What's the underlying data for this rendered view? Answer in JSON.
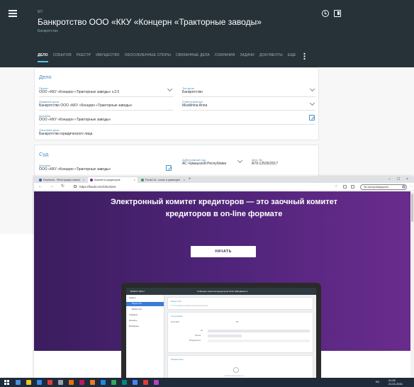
{
  "app": {
    "header": {
      "kicker": "БП",
      "title": "Банкротство ООО «ККУ «Концерн «Тракторные заводы»",
      "subtitle": "Банкротство"
    },
    "tabs": [
      "ДЕЛО",
      "СОБЫТИЯ",
      "РЕЕСТР",
      "ИМУЩЕСТВО",
      "ОБОСОБЛЕННЫЕ СПОРЫ",
      "СВЯЗАННЫЕ ДЕЛА",
      "СОБРАНИЯ",
      "ЗАДАЧИ",
      "ДОКУМЕНТЫ",
      "ЕЩЕ"
    ],
    "case_card": {
      "title": "Дело",
      "project_label": "Проект",
      "project_value": "ООО «ККУ «Концерн «Тракторные заводы» v.2.0",
      "case_type_label": "Тип дела",
      "case_type_value": "Банкротство",
      "case_name_label": "Название дела",
      "case_name_value": "Банкротство ООО «ККУ «Концерн «Тракторные заводы»",
      "responsible_label": "Ответственный",
      "responsible_value": "Musikhina Anna",
      "debtor_label": "Должник",
      "debtor_value": "ООО «ККУ «Концерн «Тракторные заводы»",
      "description_label": "Описание дела",
      "description_value": "Банкротство юридического лица"
    },
    "court_card": {
      "title": "Суд",
      "debtor_label": "Должник",
      "debtor_value": "ООО «ККУ «Концерн «Тракторные заводы»",
      "court_label": "Арбитражный суд",
      "court_value": "АС Чувашской Республики",
      "case_no_label": "Дело №",
      "case_no_value": "А79-12535/2017"
    }
  },
  "browser": {
    "tabs": [
      {
        "label": "Facebook - Регистрация нового",
        "close": "×",
        "favicon_color": "#3b5998",
        "active": false
      },
      {
        "label": "Комитеты кредиторов",
        "close": "×",
        "favicon_color": "#6a2c8e",
        "active": true
      },
      {
        "label": "Portal CA - поиск и размещен",
        "close": "×",
        "favicon_color": "#2e9e57",
        "active": false
      }
    ],
    "new_tab": "+",
    "window_controls": [
      "–",
      "☐",
      "×"
    ],
    "nav": {
      "back": "←",
      "forward": "→",
      "reload": "↻"
    },
    "url": "https://banko.tech/komitet",
    "toolbar_icons": [
      "☆",
      "⋯"
    ],
    "profile_label": "Не синхронизируется",
    "hero": {
      "line1": "Электронный комитет кредиторов — это заочный комитет",
      "line2": "кредиторов в on-line формате",
      "button": "НАЧАТЬ"
    },
    "mockup": {
      "logo": "BANKO.TECH",
      "title": "Собрание комитета кредиторов ООО ЛайтДевелоп",
      "sidebar_items": [
        "Комитет",
        "Вопрос №1",
        "Вопрос №2",
        "Собрания",
        "Контакты",
        "Материалы"
      ],
      "question_title": "Вопрос №1",
      "question_text": "О согласовании продажи имущества должника",
      "voting_title": "Голосование",
      "vote_date": "22.01.2021",
      "vote_count": "5/5",
      "vote_rows": [
        "За",
        "Против",
        "Воздержались"
      ],
      "comments_title": "Комментарии",
      "comments_empty": "Комментариев пока нет"
    }
  },
  "taskbar": {
    "icon_colors": [
      "#4a90d9",
      "#f0c419",
      "#2d8cf0",
      "#e23b3b",
      "#9aa0a6",
      "#e8710a",
      "#c2185b",
      "#e57c23",
      "#1e88e5",
      "#34a853",
      "#00897b",
      "#4285f4",
      "#e53935",
      "#ab47bc"
    ],
    "lang": "RU",
    "time": "21:52",
    "date": "21.01.2021"
  },
  "colors": {
    "accent": "#4a8ec2",
    "header_bg": "#263238",
    "hero_start": "#3b1d5e",
    "hero_end": "#6a2c8e"
  }
}
